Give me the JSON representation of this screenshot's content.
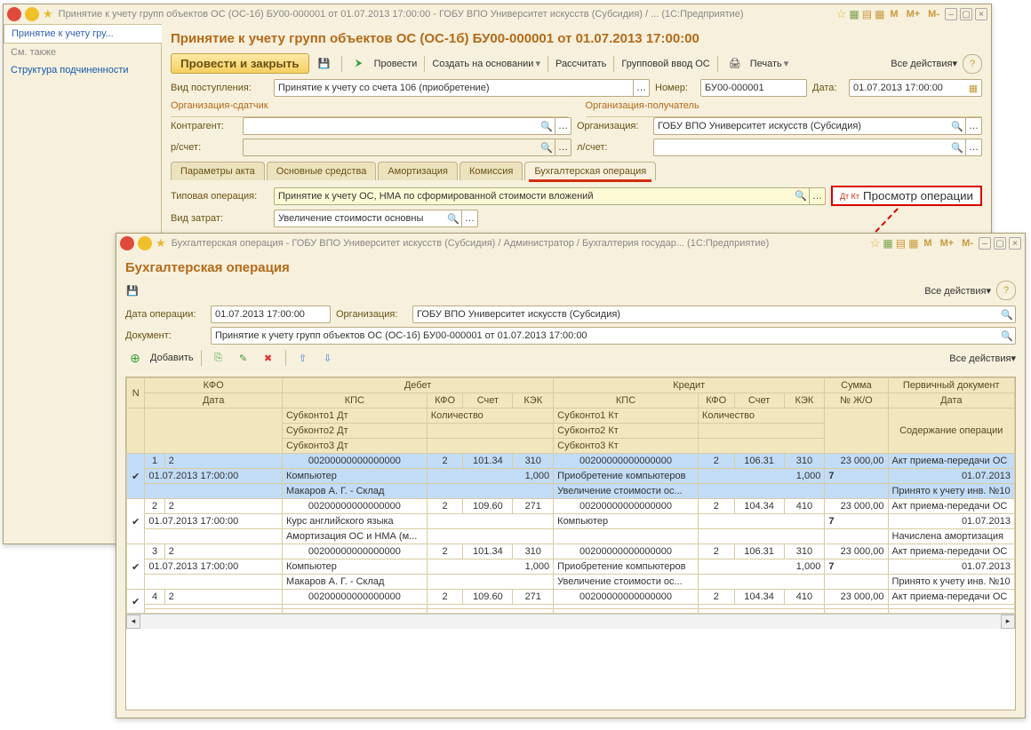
{
  "main_window": {
    "title": "Принятие к учету групп объектов ОС (ОС-1б) БУ00-000001 от 01.07.2013 17:00:00 - ГОБУ ВПО Университет искусств (Субсидия) / ...  (1С:Предприятие)",
    "doc_title": "Принятие к учету групп объектов ОС (ОС-1б) БУ00-000001 от 01.07.2013 17:00:00",
    "nav": {
      "selected": "Принятие к учету гру...",
      "see_also": "См. также",
      "structure": "Структура подчиненности"
    },
    "toolbar": {
      "post_close": "Провести и закрыть",
      "post": "Провести",
      "create_based": "Создать на основании",
      "recalc": "Рассчитать",
      "group_input": "Групповой ввод ОС",
      "print": "Печать",
      "all_actions": "Все действия"
    },
    "form": {
      "vid_post_label": "Вид поступления:",
      "vid_post_value": "Принятие к учету со счета 106 (приобретение)",
      "number_label": "Номер:",
      "number_value": "БУ00-000001",
      "date_label": "Дата:",
      "date_value": "01.07.2013 17:00:00",
      "org_sdat": "Организация-сдатчик",
      "org_pol": "Организация-получатель",
      "kontragent_label": "Контрагент:",
      "kontragent_value": "",
      "org_label": "Организация:",
      "org_value": "ГОБУ ВПО Университет искусств (Субсидия)",
      "rschet_label": "р/счет:",
      "lschet_label": "л/счет:",
      "tabs": [
        "Параметры акта",
        "Основные средства",
        "Амортизация",
        "Комиссия",
        "Бухгалтерская операция"
      ],
      "typical_op_label": "Типовая операция:",
      "typical_op_value": "Принятие к учету ОС, НМА по сформированной стоимости вложений",
      "view_op_btn": "Просмотр операции",
      "vid_zatrat_label": "Вид затрат:",
      "vid_zatrat_value": "Увеличение стоимости основны"
    }
  },
  "sub_window": {
    "title": "Бухгалтерская операция - ГОБУ ВПО Университет искусств (Субсидия) / Администратор / Бухгалтерия государ...  (1С:Предприятие)",
    "op_title": "Бухгалтерская операция",
    "m_btns": [
      "M",
      "M+",
      "M-"
    ],
    "all_actions": "Все действия",
    "form": {
      "date_label": "Дата операции:",
      "date_value": "01.07.2013 17:00:00",
      "org_label": "Организация:",
      "org_value": "ГОБУ ВПО Университет искусств (Субсидия)",
      "doc_label": "Документ:",
      "doc_value": "Принятие к учету групп объектов ОС (ОС-1б) БУ00-000001 от 01.07.2013 17:00:00"
    },
    "add_btn": "Добавить",
    "headers": {
      "n": "N",
      "kfo": "КФО",
      "debet": "Дебет",
      "kredit": "Кредит",
      "summa": "Сумма",
      "primary": "Первичный документ",
      "date": "Дата",
      "kps": "КПС",
      "kfo2": "КФО",
      "schet": "Счет",
      "kek": "КЭК",
      "njo": "№ Ж/О",
      "date2": "Дата",
      "sub1d": "Субконто1 Дт",
      "kolvo": "Количество",
      "sub1k": "Субконто1 Кт",
      "soderzh": "Содержание операции",
      "sub2d": "Субконто2 Дт",
      "sub2k": "Субконто2 Кт",
      "sub3d": "Субконто3 Дт",
      "sub3k": "Субконто3 Кт"
    },
    "rows": [
      {
        "n": "1",
        "kfo": "2",
        "date": "01.07.2013 17:00:00",
        "d_kps": "00200000000000000",
        "d_kfo": "2",
        "d_schet": "101.34",
        "d_kek": "310",
        "d_qty": "1,000",
        "d_s1": "Компьютер",
        "d_s2": "Макаров А. Г. - Склад",
        "k_kps": "00200000000000000",
        "k_kfo": "2",
        "k_schet": "106.31",
        "k_kek": "310",
        "k_qty": "1,000",
        "k_s1": "Приобретение компьютеров",
        "k_s2": "Увеличение стоимости ос...",
        "sum": "23 000,00",
        "njo": "7",
        "doc": "Акт приема-передачи ОС",
        "doc_date": "01.07.2013",
        "soderzh": "Принято к учету инв. №10"
      },
      {
        "n": "2",
        "kfo": "2",
        "date": "01.07.2013 17:00:00",
        "d_kps": "00200000000000000",
        "d_kfo": "2",
        "d_schet": "109.60",
        "d_kek": "271",
        "d_qty": "",
        "d_s1": "Курс английского языка",
        "d_s2": "Амортизация ОС и НМА (м...",
        "k_kps": "00200000000000000",
        "k_kfo": "2",
        "k_schet": "104.34",
        "k_kek": "410",
        "k_qty": "",
        "k_s1": "Компьютер",
        "k_s2": "",
        "sum": "23 000,00",
        "njo": "7",
        "doc": "Акт приема-передачи ОС",
        "doc_date": "01.07.2013",
        "soderzh": "Начислена амортизация"
      },
      {
        "n": "3",
        "kfo": "2",
        "date": "01.07.2013 17:00:00",
        "d_kps": "00200000000000000",
        "d_kfo": "2",
        "d_schet": "101.34",
        "d_kek": "310",
        "d_qty": "1,000",
        "d_s1": "Компьютер",
        "d_s2": "Макаров А. Г. - Склад",
        "k_kps": "00200000000000000",
        "k_kfo": "2",
        "k_schet": "106.31",
        "k_kek": "310",
        "k_qty": "1,000",
        "k_s1": "Приобретение компьютеров",
        "k_s2": "Увеличение стоимости ос...",
        "sum": "23 000,00",
        "njo": "7",
        "doc": "Акт приема-передачи ОС",
        "doc_date": "01.07.2013",
        "soderzh": "Принято к учету инв. №10"
      },
      {
        "n": "4",
        "kfo": "2",
        "date": "",
        "d_kps": "00200000000000000",
        "d_kfo": "2",
        "d_schet": "109.60",
        "d_kek": "271",
        "d_qty": "",
        "d_s1": "",
        "d_s2": "",
        "k_kps": "00200000000000000",
        "k_kfo": "2",
        "k_schet": "104.34",
        "k_kek": "410",
        "k_qty": "",
        "k_s1": "",
        "k_s2": "",
        "sum": "23 000,00",
        "njo": "",
        "doc": "Акт приема-передачи ОС",
        "doc_date": "",
        "soderzh": ""
      }
    ]
  }
}
